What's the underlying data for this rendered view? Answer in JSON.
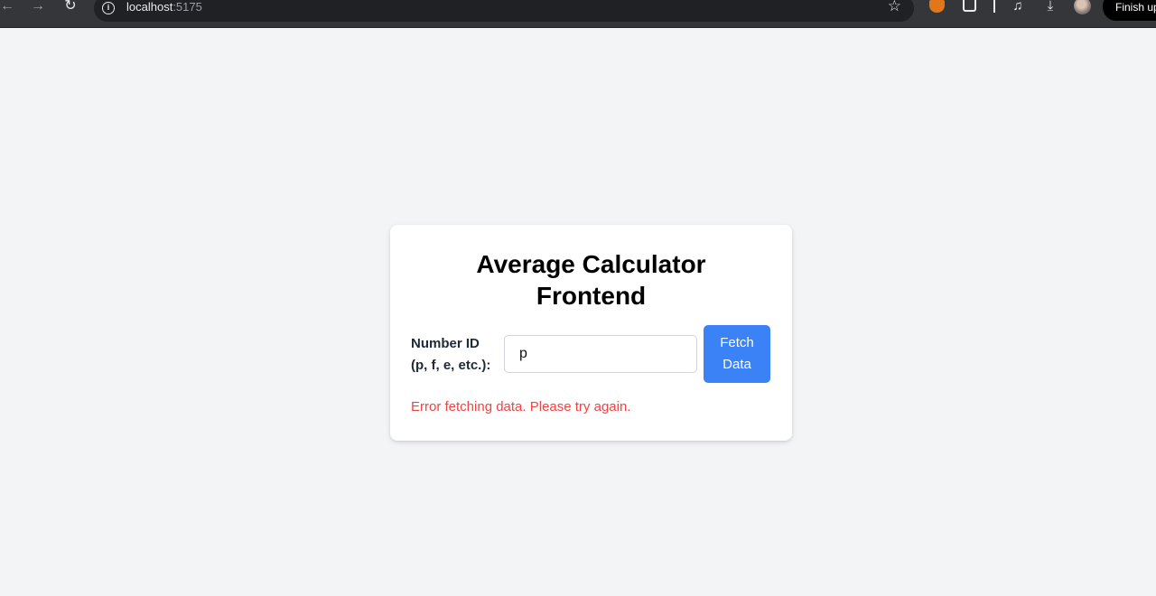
{
  "browser": {
    "back_icon": "arrow-left-icon",
    "forward_icon": "arrow-right-icon",
    "reload_icon": "reload-icon",
    "url_host": "localhost",
    "url_port": ":5175",
    "finish_label": "Finish update"
  },
  "card": {
    "title_line1": "Average Calculator",
    "title_line2": "Frontend",
    "label_line1": "Number ID",
    "label_line2": "(p, f, e, etc.):",
    "input_value": "p",
    "button_line1": "Fetch",
    "button_line2": "Data",
    "error_message": "Error fetching data. Please try again."
  },
  "colors": {
    "page_bg": "#f3f4f6",
    "button_bg": "#3b82f6",
    "error": "#ef4444"
  }
}
